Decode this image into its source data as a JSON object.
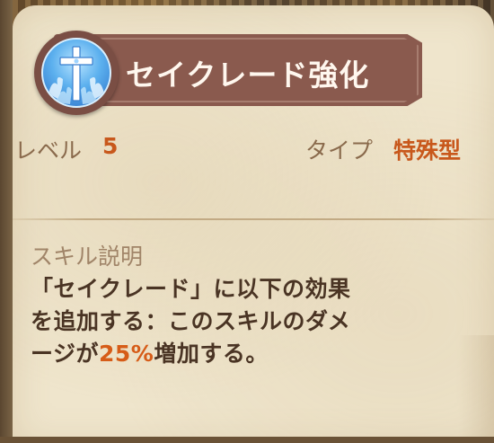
{
  "skill": {
    "title": "セイクレード強化",
    "icon": "holy-cross-icon"
  },
  "stats": {
    "level_label": "レベル",
    "level_value": "5",
    "type_label": "タイプ",
    "type_value": "特殊型"
  },
  "description": {
    "heading": "スキル説明",
    "line1": "「セイクレード」に以下の効果",
    "line2": "を追加する：このスキルのダメ",
    "line3_before": "ージが",
    "line3_highlight": "25%",
    "line3_after": "増加する。"
  },
  "colors": {
    "accent": "#c8581c",
    "banner": "#8a5a4e",
    "panel": "#efe5cc"
  }
}
